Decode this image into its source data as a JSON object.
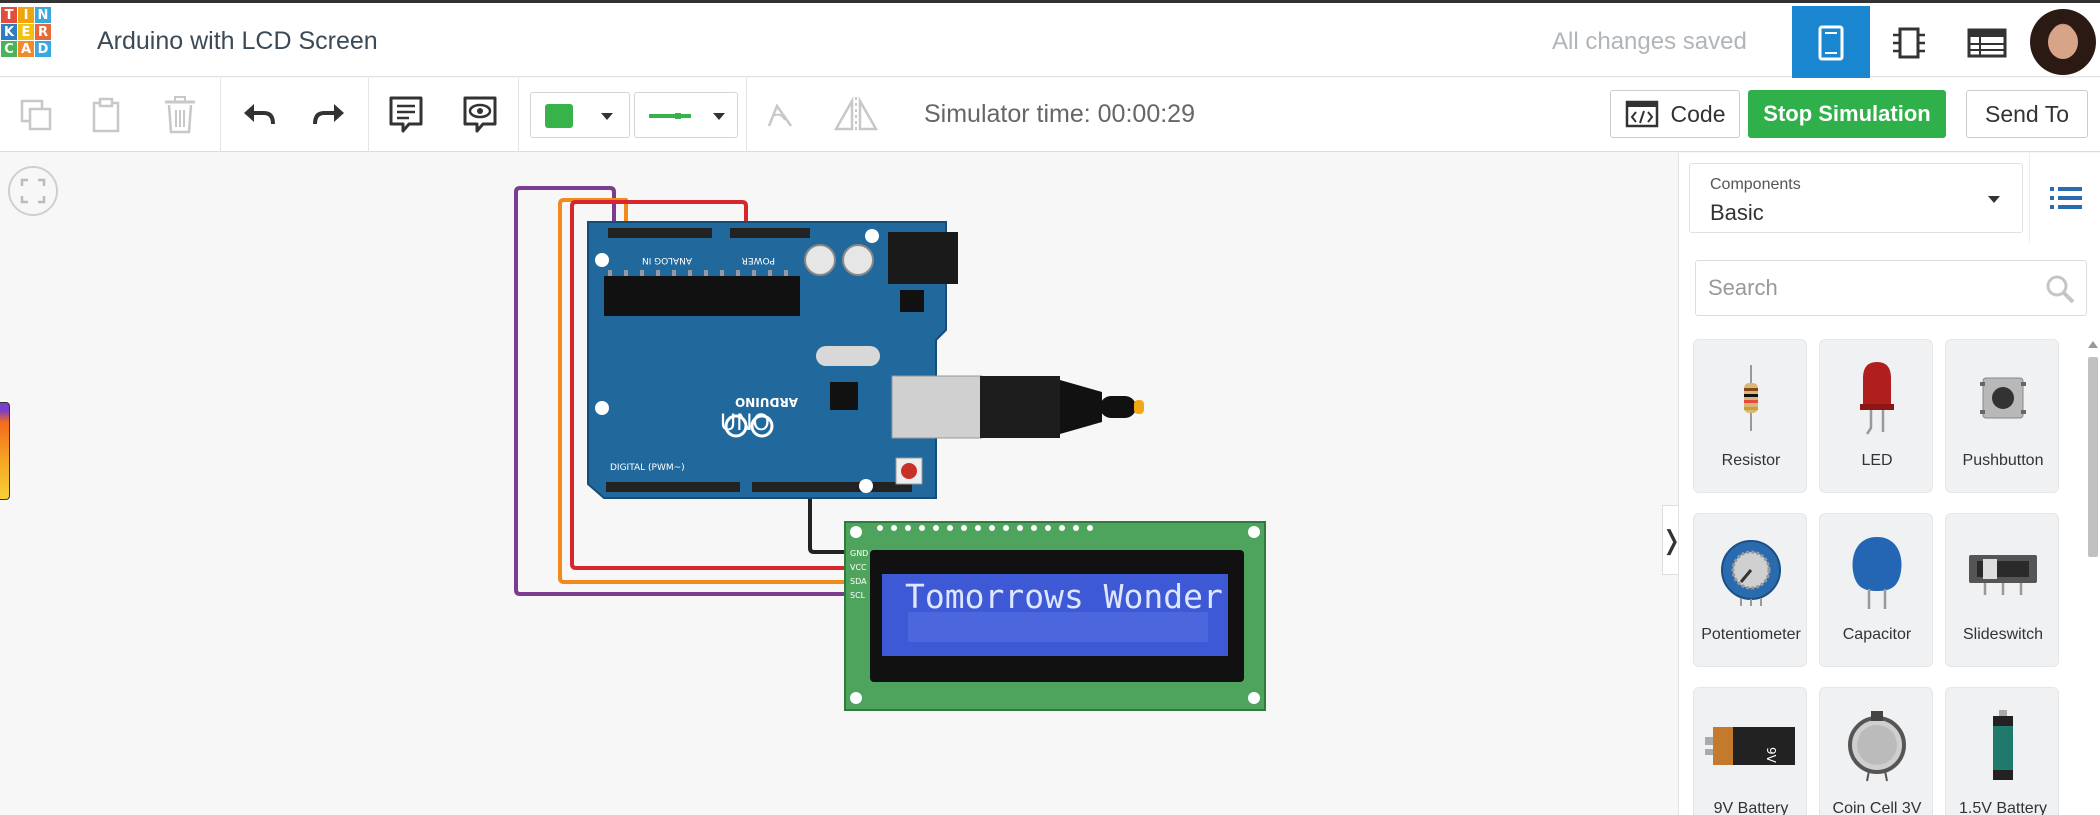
{
  "app": {
    "name": "Tinkercad",
    "logo_letters": [
      "T",
      "I",
      "N",
      "K",
      "E",
      "R",
      "C",
      "A",
      "D"
    ]
  },
  "header": {
    "project_title": "Arduino with LCD Screen",
    "save_status": "All changes saved",
    "views": [
      "circuit-view",
      "schematic-view",
      "component-list-view"
    ]
  },
  "toolbar": {
    "tools": [
      "copy-icon",
      "paste-icon",
      "delete-icon",
      "undo-icon",
      "redo-icon",
      "notes-icon",
      "notes-visibility-icon",
      "flip-icon",
      "mirror-icon"
    ],
    "color_value": "#37b34a",
    "wire_type_color": "#37b34a",
    "simulator_time": "Simulator time: 00:00:29",
    "code_label": "Code",
    "stop_label": "Stop Simulation",
    "send_to_label": "Send To"
  },
  "circuit": {
    "arduino_label": "UNO",
    "arduino_brand": "ARDUINO",
    "header_labels": [
      "ANALOG IN",
      "POWER",
      "DIGITAL (PWM~)"
    ],
    "lcd_pins": [
      "GND",
      "VCC",
      "SDA",
      "SCL"
    ],
    "lcd_text": "Tomorrows Wonder",
    "wire_colors": {
      "purple": "#7b3b8f",
      "orange": "#f08a1c",
      "red": "#d7262c",
      "black": "#222222"
    }
  },
  "panel": {
    "components_label": "Components",
    "components_value": "Basic",
    "search_placeholder": "Search",
    "parts": [
      {
        "name": "Resistor",
        "icon": "resistor-icon"
      },
      {
        "name": "LED",
        "icon": "led-icon"
      },
      {
        "name": "Pushbutton",
        "icon": "pushbutton-icon"
      },
      {
        "name": "Potentiometer",
        "icon": "potentiometer-icon"
      },
      {
        "name": "Capacitor",
        "icon": "capacitor-icon"
      },
      {
        "name": "Slideswitch",
        "icon": "slideswitch-icon"
      },
      {
        "name": "9V Battery",
        "icon": "battery-9v-icon"
      },
      {
        "name": "Coin Cell 3V",
        "icon": "coin-cell-icon"
      },
      {
        "name": "1.5V Battery",
        "icon": "battery-aa-icon"
      }
    ]
  },
  "colors": {
    "accent": "#1a86d0",
    "stop": "#2fb04a"
  }
}
